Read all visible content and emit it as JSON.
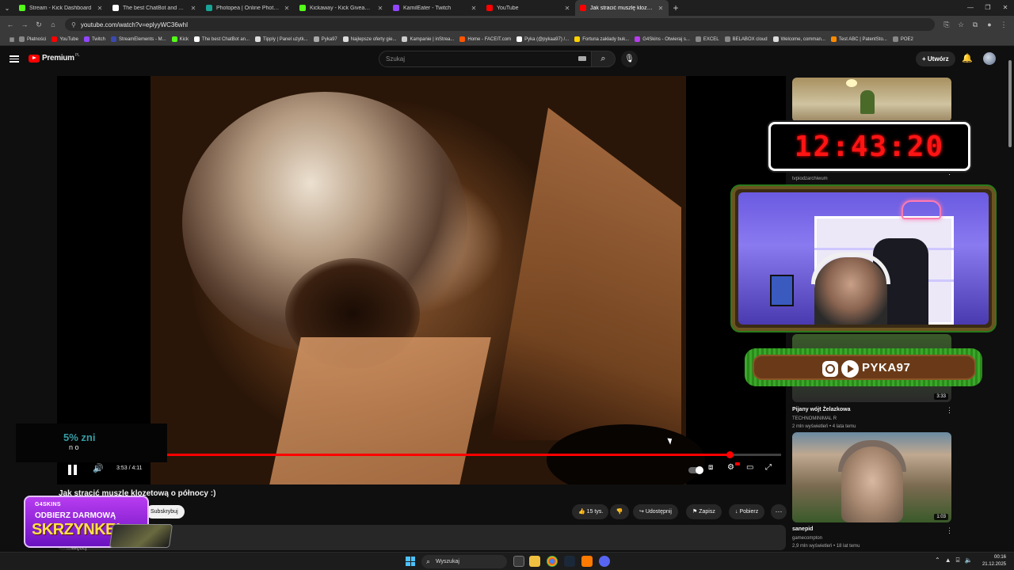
{
  "browser": {
    "tabs": [
      {
        "label": "Stream - Kick Dashboard",
        "color": "#53fc18",
        "active": false
      },
      {
        "label": "The best ChatBot and Widgets",
        "color": "#ffffff",
        "active": false
      },
      {
        "label": "Photopea | Online Photo Editor",
        "color": "#18a497",
        "active": false
      },
      {
        "label": "Kickaway - Kick Giveaway Tool",
        "color": "#53fc18",
        "active": false
      },
      {
        "label": "KamilEater - Twitch",
        "color": "#9146ff",
        "active": false
      },
      {
        "label": "YouTube",
        "color": "#ff0000",
        "active": false
      },
      {
        "label": "Jak stracić muszlę klozetową",
        "color": "#ff0000",
        "active": true
      }
    ],
    "url": "youtube.com/watch?v=eplyyWC36whI",
    "bookmarks": [
      {
        "label": "Płatności",
        "color": "#888888"
      },
      {
        "label": "YouTube",
        "color": "#ff0000"
      },
      {
        "label": "Twitch",
        "color": "#9146ff"
      },
      {
        "label": "StreamElements - M...",
        "color": "#3a4ab0"
      },
      {
        "label": "Kick",
        "color": "#53fc18"
      },
      {
        "label": "The best ChatBot an...",
        "color": "#ffffff"
      },
      {
        "label": "Tipply | Panel użytk...",
        "color": "#dddddd"
      },
      {
        "label": "Pyka97",
        "color": "#aaaaaa"
      },
      {
        "label": "Najlepsze oferty gie...",
        "color": "#dddddd"
      },
      {
        "label": "Kampanie | inStrea...",
        "color": "#cccccc"
      },
      {
        "label": "Home - FACEIT.com",
        "color": "#ff5500"
      },
      {
        "label": "Pyka (@pykaa97) /...",
        "color": "#ffffff"
      },
      {
        "label": "Fortuna zakłady buk...",
        "color": "#ffd200"
      },
      {
        "label": "G4Skins - Otwieraj s...",
        "color": "#b83cf0"
      },
      {
        "label": "EXCEL",
        "color": "#888888"
      },
      {
        "label": "BELABOX cloud",
        "color": "#888888"
      },
      {
        "label": "Welcome, comman...",
        "color": "#dddddd"
      },
      {
        "label": "Test ABC | PatentSto...",
        "color": "#ff8a00"
      },
      {
        "label": "POE2",
        "color": "#888888"
      }
    ]
  },
  "youtube": {
    "logo_text": "Premium",
    "logo_country": "PL",
    "search_placeholder": "Szukaj",
    "create_label": "Utwórz",
    "player": {
      "time": "3:53 / 4:11",
      "progress": 0.928,
      "overlay_text": "5% zni",
      "overlay_sub": "n o"
    },
    "video_title": "Jak stracić muszlę klozetową o północy :)",
    "subscribe_label": "Subskrybuj",
    "actions": {
      "likes": "15 tys.",
      "share": "Udostępnij",
      "save": "Zapisz",
      "download": "Pobierz"
    },
    "description_fragment": "...więcej"
  },
  "sidebar": [
    {
      "title": "",
      "channel": "tvpiodzarchiwum",
      "meta": ""
    },
    {
      "title": "Pijany wójt Żelazkowa",
      "channel": "TECHNOMINIMAL R",
      "meta": "2 mln wyświetleń • 4 lata temu",
      "duration": "3:33"
    },
    {
      "title": "sanepid",
      "channel": "gamecompton",
      "meta": "2,9 mln wyświetleń • 18 lat temu",
      "duration": "1:03"
    }
  ],
  "stream_overlay": {
    "timer": "12:43:20",
    "social_name": "PYKA97",
    "promo_logo": "G4SKINS",
    "promo_line1": "ODBIERZ DARMOWĄ",
    "promo_line2": "SKRZYNKĘ!"
  },
  "taskbar": {
    "search_label": "Wyszukaj",
    "time": "00:16",
    "date": "21.12.2025"
  }
}
